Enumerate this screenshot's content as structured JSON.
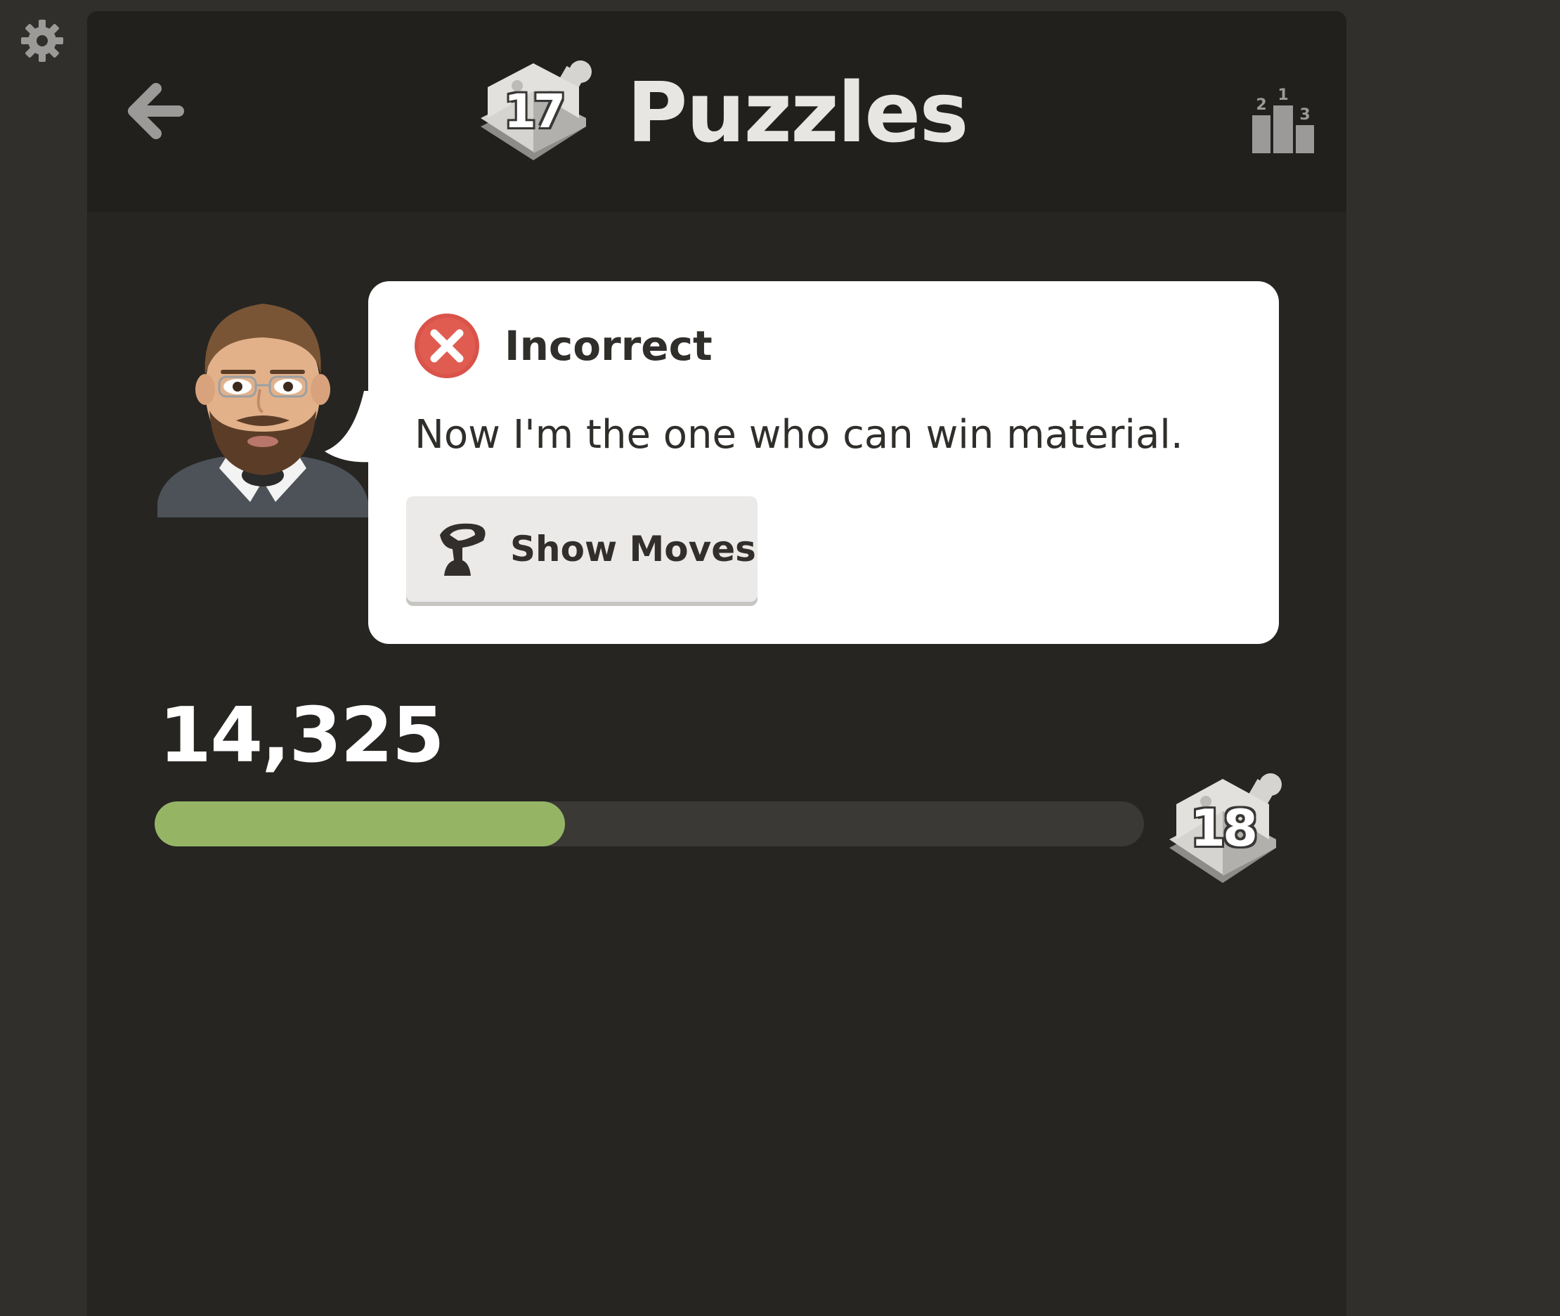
{
  "header": {
    "title": "Puzzles",
    "level": "17"
  },
  "coach": {
    "status": "Incorrect",
    "message": "Now I'm the one who can win material.",
    "show_moves_label": "Show Moves"
  },
  "progress": {
    "score": "14,325",
    "fill_fraction": 0.415,
    "next_level": "18"
  },
  "colors": {
    "background": "#312f2c",
    "panel": "#262522",
    "header": "#21201d",
    "progress_fill": "#95b565",
    "progress_track": "#3a3936",
    "error": "#d9534a"
  },
  "icons": {
    "settings": "gear-icon",
    "back": "back-arrow-icon",
    "leaderboard": "leaderboard-icon",
    "status": "incorrect-x-icon",
    "show_moves": "pawn-icon"
  }
}
